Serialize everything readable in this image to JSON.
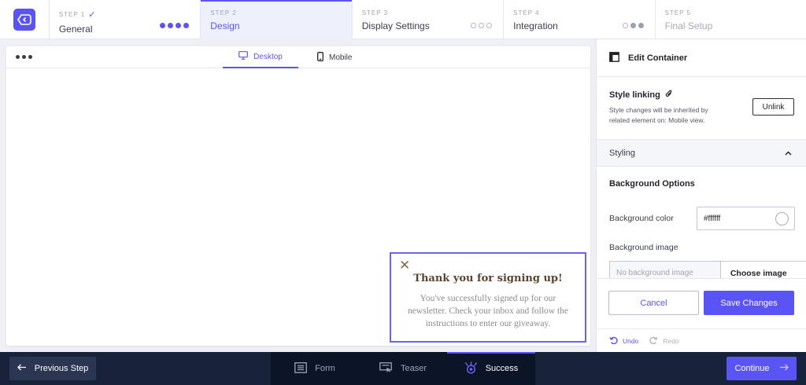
{
  "steps": [
    {
      "number": "STEP 1",
      "title": "General",
      "completed_mark": "✓"
    },
    {
      "number": "STEP 2",
      "title": "Design"
    },
    {
      "number": "STEP 3",
      "title": "Display Settings"
    },
    {
      "number": "STEP 4",
      "title": "Integration"
    },
    {
      "number": "STEP 5",
      "title": "Final Setup"
    }
  ],
  "preview": {
    "device_tabs": {
      "desktop": "Desktop",
      "mobile": "Mobile"
    },
    "popup": {
      "close": "✕",
      "title": "Thank you for signing up!",
      "body": "You've successfully signed up for our newsletter. Check your inbox and follow the instructions to enter our giveaway."
    }
  },
  "panel": {
    "title": "Edit Container",
    "style_linking": {
      "title": "Style linking",
      "description": "Style changes will be inherited by related element on: Mobile view.",
      "unlink_label": "Unlink"
    },
    "styling": {
      "label": "Styling",
      "background_options": "Background Options",
      "background_color_label": "Background color",
      "background_color_value": "#ffffff",
      "background_image_label": "Background image",
      "background_image_placeholder": "No background image",
      "choose_image_label": "Choose image"
    },
    "cancel_label": "Cancel",
    "save_label": "Save Changes",
    "undo_label": "Undo",
    "redo_label": "Redo"
  },
  "bottom": {
    "previous_label": "Previous Step",
    "tabs": [
      "Form",
      "Teaser",
      "Success"
    ],
    "continue_label": "Continue"
  },
  "colors": {
    "accent": "#5b54f5",
    "bottom_bar": "#18223b",
    "popup_text": "#5a4430"
  },
  "icons": [
    "logo-icon",
    "check-icon",
    "more-icon",
    "desktop-icon",
    "mobile-icon",
    "close-icon",
    "container-icon",
    "paperclip-icon",
    "chevron-up-icon",
    "undo-icon",
    "redo-icon",
    "arrow-left-icon",
    "form-icon",
    "teaser-icon",
    "success-icon",
    "arrow-right-icon"
  ]
}
